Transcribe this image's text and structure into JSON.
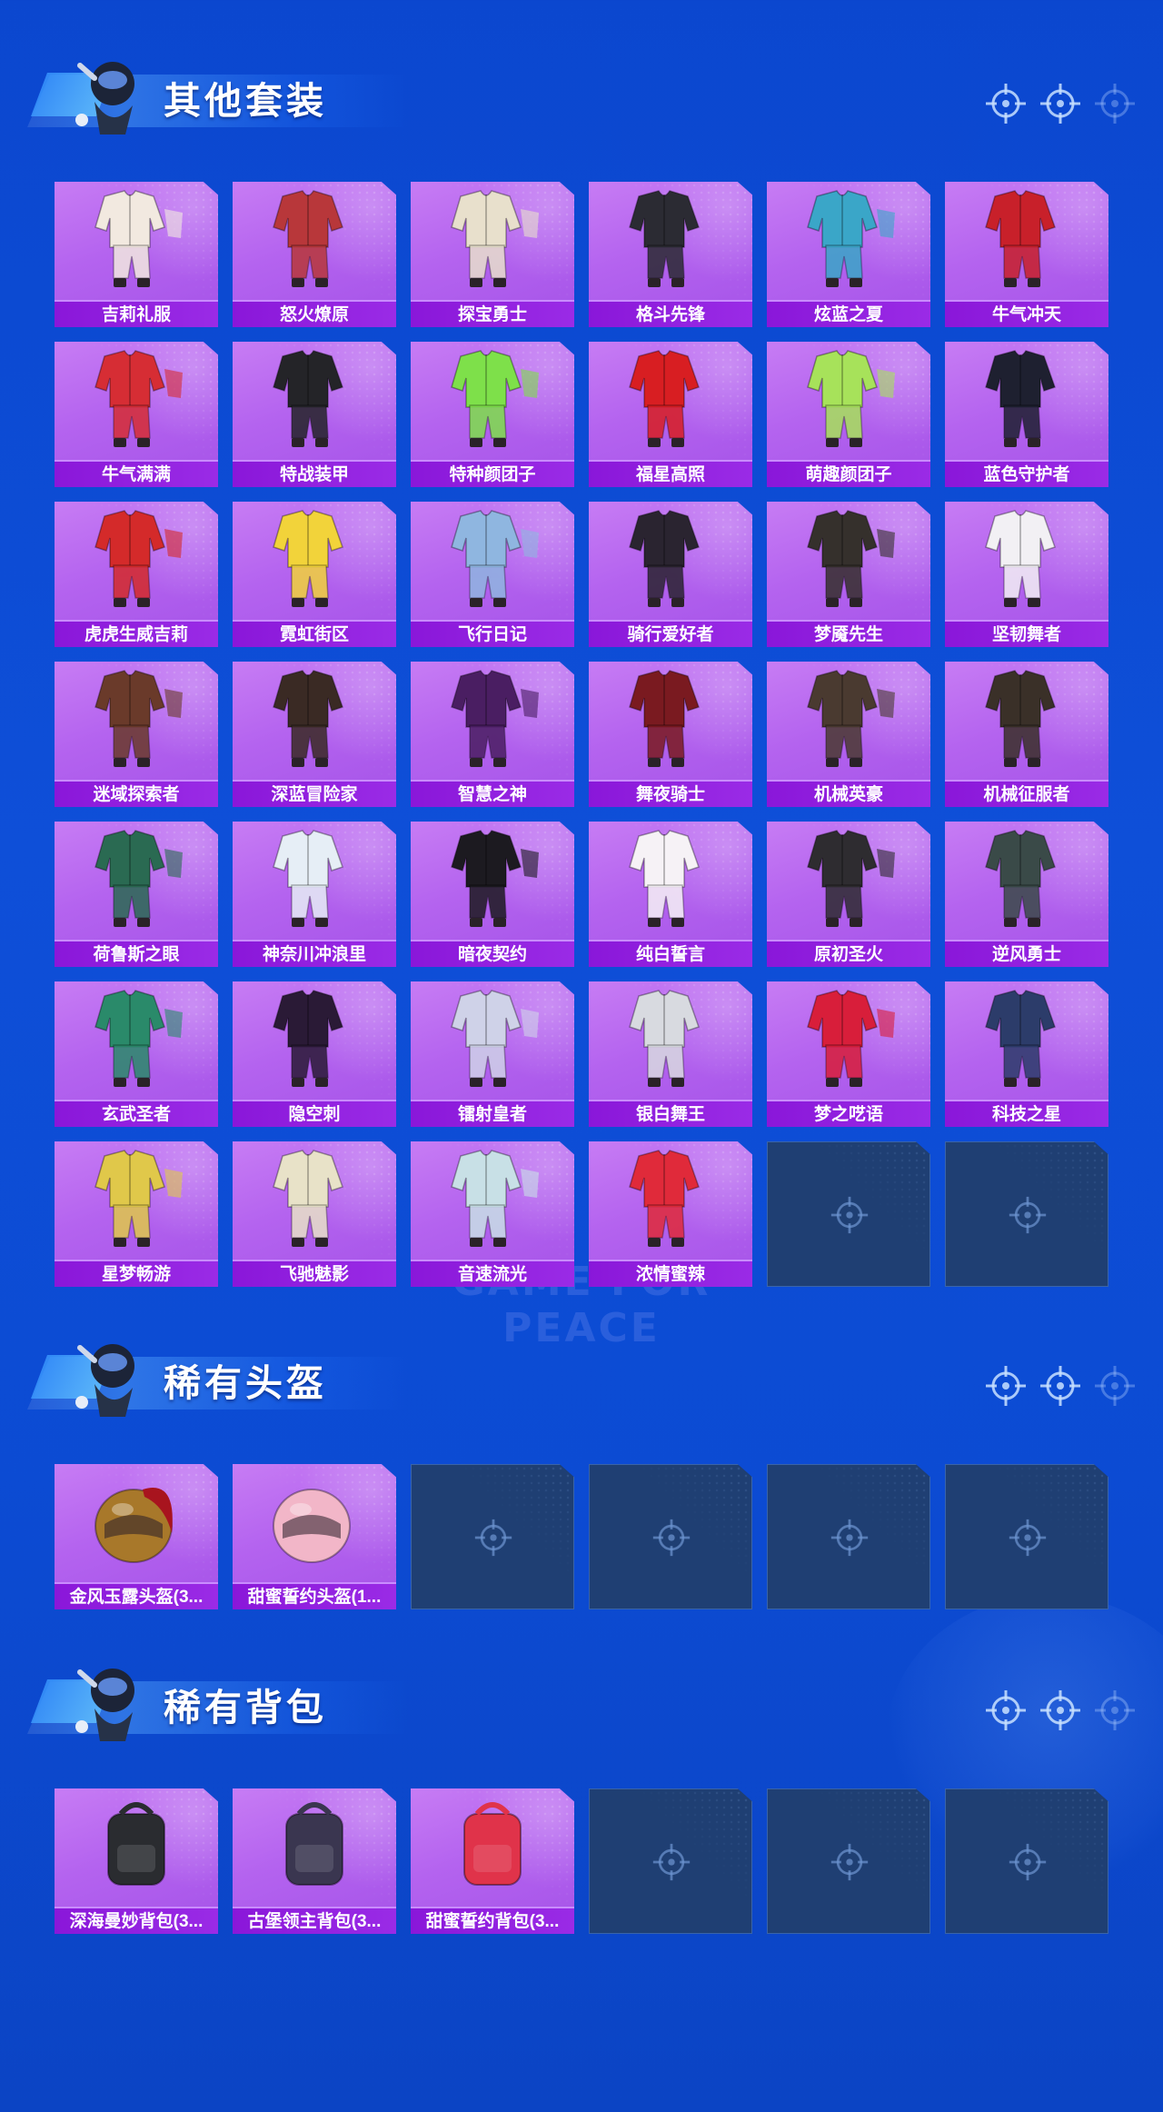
{
  "sections": [
    {
      "id": "suits",
      "title": "其他套装",
      "items": [
        {
          "name": "吉莉礼服",
          "color": "#f2e9e0"
        },
        {
          "name": "怒火燎原",
          "color": "#b8373a"
        },
        {
          "name": "探宝勇士",
          "color": "#e8e0cc"
        },
        {
          "name": "格斗先锋",
          "color": "#2b2b33"
        },
        {
          "name": "炫蓝之夏",
          "color": "#3aa6c8"
        },
        {
          "name": "牛气冲天",
          "color": "#c8202a"
        },
        {
          "name": "牛气满满",
          "color": "#d62d34"
        },
        {
          "name": "特战装甲",
          "color": "#242428"
        },
        {
          "name": "特种颜团子",
          "color": "#7ee04a"
        },
        {
          "name": "福星高照",
          "color": "#d81e22"
        },
        {
          "name": "萌趣颜团子",
          "color": "#a7e25a"
        },
        {
          "name": "蓝色守护者",
          "color": "#1e2030"
        },
        {
          "name": "虎虎生威吉莉",
          "color": "#d42a2a"
        },
        {
          "name": "霓虹街区",
          "color": "#f2d33a"
        },
        {
          "name": "飞行日记",
          "color": "#8fb6e0"
        },
        {
          "name": "骑行爱好者",
          "color": "#2a2430"
        },
        {
          "name": "梦魇先生",
          "color": "#35302c"
        },
        {
          "name": "坚韧舞者",
          "color": "#f2f0f4"
        },
        {
          "name": "迷域探索者",
          "color": "#6a3a2a"
        },
        {
          "name": "深蓝冒险家",
          "color": "#3a2a24"
        },
        {
          "name": "智慧之神",
          "color": "#4a1e62"
        },
        {
          "name": "舞夜骑士",
          "color": "#7a1a20"
        },
        {
          "name": "机械英豪",
          "color": "#4a3a30"
        },
        {
          "name": "机械征服者",
          "color": "#3a3028"
        },
        {
          "name": "荷鲁斯之眼",
          "color": "#2a6a52"
        },
        {
          "name": "神奈川冲浪里",
          "color": "#e6eef6"
        },
        {
          "name": "暗夜契约",
          "color": "#1c1a20"
        },
        {
          "name": "纯白誓言",
          "color": "#f6f2f6"
        },
        {
          "name": "原初圣火",
          "color": "#2e2c30"
        },
        {
          "name": "逆风勇士",
          "color": "#3a4a48"
        },
        {
          "name": "玄武圣者",
          "color": "#2a8a6a"
        },
        {
          "name": "隐空刺",
          "color": "#2a1a36"
        },
        {
          "name": "镭射皇者",
          "color": "#cfd2e8"
        },
        {
          "name": "银白舞王",
          "color": "#d8dae0"
        },
        {
          "name": "梦之呓语",
          "color": "#d81e3a"
        },
        {
          "name": "科技之星",
          "color": "#2c3c6a"
        },
        {
          "name": "星梦畅游",
          "color": "#e0c84a"
        },
        {
          "name": "飞驰魅影",
          "color": "#e8e2c8"
        },
        {
          "name": "音速流光",
          "color": "#c8e0e6"
        },
        {
          "name": "浓情蜜辣",
          "color": "#e02a3a"
        }
      ],
      "empty_count": 2
    },
    {
      "id": "helmets",
      "title": "稀有头盔",
      "items": [
        {
          "name": "金风玉露头盔(3...",
          "color": "#a8782a"
        },
        {
          "name": "甜蜜誓约头盔(1...",
          "color": "#f2b6c8"
        }
      ],
      "empty_count": 4
    },
    {
      "id": "backpacks",
      "title": "稀有背包",
      "items": [
        {
          "name": "深海曼妙背包(3...",
          "color": "#2a2c30"
        },
        {
          "name": "古堡领主背包(3...",
          "color": "#3a3650"
        },
        {
          "name": "甜蜜誓约背包(3...",
          "color": "#e0334a"
        }
      ],
      "empty_count": 3
    }
  ]
}
